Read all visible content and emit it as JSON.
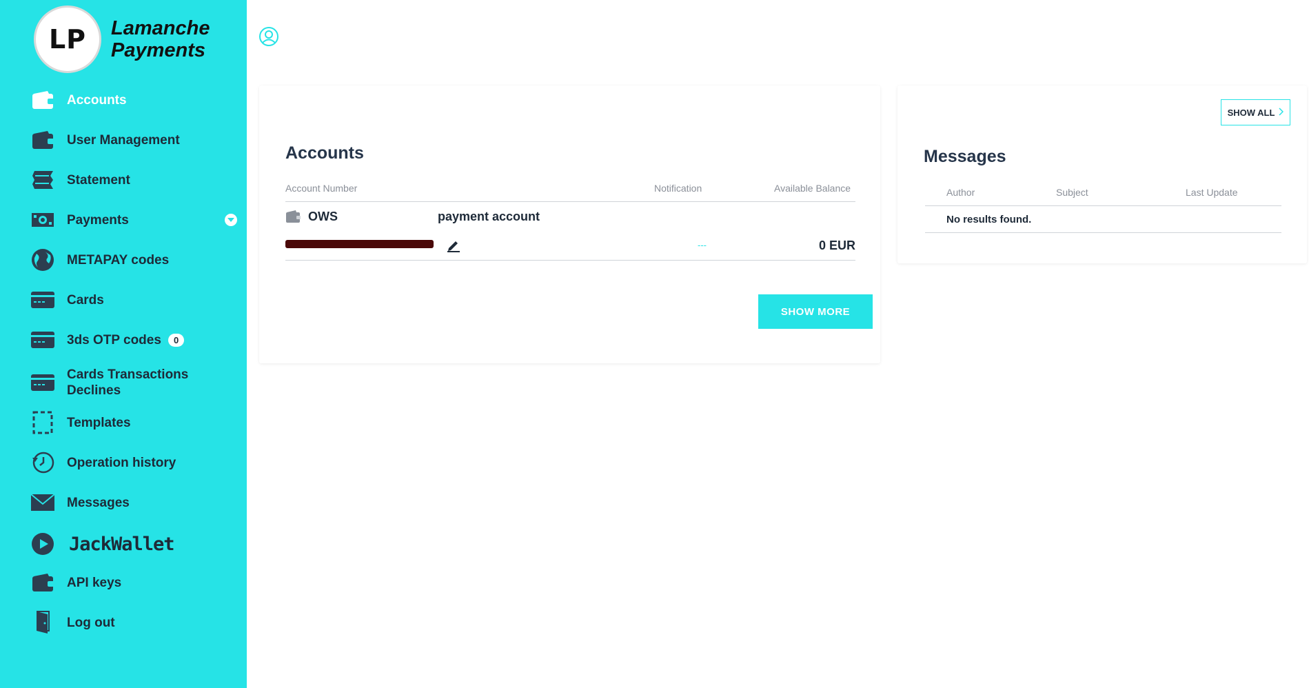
{
  "brand": {
    "logo_text": "LP",
    "name": "Lamanche Payments"
  },
  "nav": [
    {
      "label": "Accounts",
      "icon": "wallet-icon",
      "active": true
    },
    {
      "label": "User Management",
      "icon": "wallet-icon"
    },
    {
      "label": "Statement",
      "icon": "statement-icon"
    },
    {
      "label": "Payments",
      "icon": "money-icon",
      "has_dropdown": true
    },
    {
      "label": "METAPAY codes",
      "icon": "globe-icon"
    },
    {
      "label": "Cards",
      "icon": "card-icon"
    },
    {
      "label": "3ds OTP codes",
      "icon": "card-icon",
      "badge": "0"
    },
    {
      "label": "Cards Transactions Declines",
      "icon": "card-icon"
    },
    {
      "label": "Templates",
      "icon": "dashed-square-icon"
    },
    {
      "label": "Operation history",
      "icon": "history-icon"
    },
    {
      "label": "Messages",
      "icon": "envelope-icon"
    },
    {
      "label": "JackWallet",
      "icon": "play-icon"
    },
    {
      "label": "API keys",
      "icon": "wallet-icon"
    },
    {
      "label": "Log out",
      "icon": "door-icon"
    }
  ],
  "accounts": {
    "title": "Accounts",
    "columns": {
      "account_number": "Account Number",
      "notification": "Notification",
      "available_balance": "Available Balance"
    },
    "rows": [
      {
        "name": "OWS",
        "description": "payment account",
        "notification": "---",
        "balance": "0 EUR"
      }
    ],
    "show_more": "SHOW MORE"
  },
  "messages": {
    "title": "Messages",
    "show_all": "SHOW ALL",
    "columns": {
      "author": "Author",
      "subject": "Subject",
      "last_update": "Last Update"
    },
    "empty_text": "No results found."
  },
  "colors": {
    "accent": "#26e3e6",
    "text_dark": "#1e2a38",
    "redaction": "#4a0808"
  }
}
